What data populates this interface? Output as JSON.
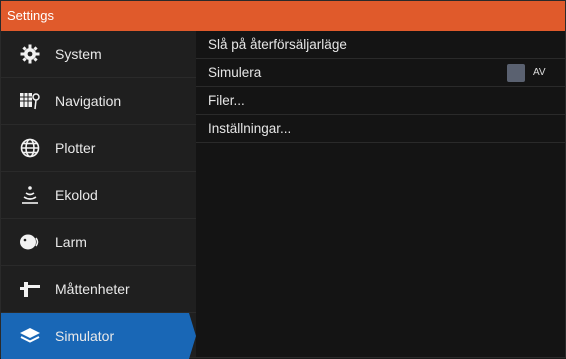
{
  "title": "Settings",
  "sidebar": {
    "items": [
      {
        "label": "System",
        "icon": "gear-icon"
      },
      {
        "label": "Navigation",
        "icon": "navigation-icon"
      },
      {
        "label": "Plotter",
        "icon": "globe-icon"
      },
      {
        "label": "Ekolod",
        "icon": "sonar-icon"
      },
      {
        "label": "Larm",
        "icon": "alarm-icon"
      },
      {
        "label": "Måttenheter",
        "icon": "units-icon"
      },
      {
        "label": "Simulator",
        "icon": "layers-icon",
        "active": true
      }
    ]
  },
  "content": {
    "rows": [
      {
        "label": "Slå på återförsäljarläge"
      },
      {
        "label": "Simulera",
        "toggle": {
          "state": "AV",
          "on": false
        }
      },
      {
        "label": "Filer..."
      },
      {
        "label": "Inställningar..."
      }
    ]
  },
  "colors": {
    "titlebar": "#e05a2b",
    "active_item": "#1967b6",
    "toggle_knob": "#5a6170"
  }
}
